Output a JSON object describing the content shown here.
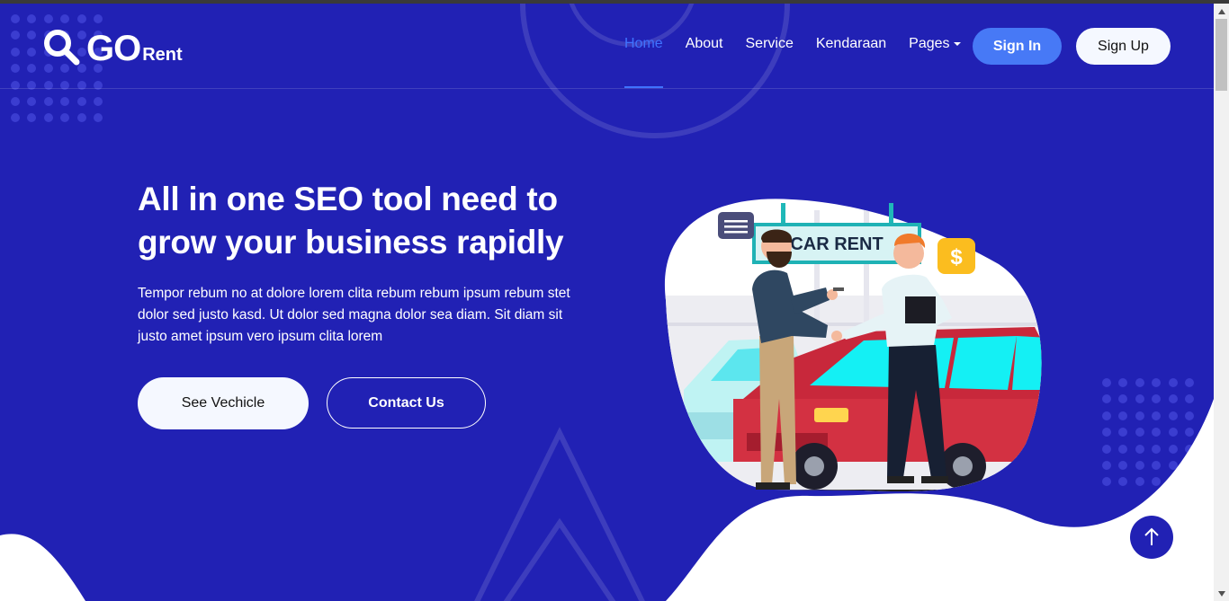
{
  "brand": {
    "name_main": "GO",
    "name_sub": "Rent",
    "icon": "search-icon"
  },
  "nav": {
    "items": [
      {
        "label": "Home",
        "active": true
      },
      {
        "label": "About"
      },
      {
        "label": "Service"
      },
      {
        "label": "Kendaraan"
      },
      {
        "label": "Pages",
        "dropdown": true
      }
    ],
    "signin_label": "Sign In",
    "signup_label": "Sign Up"
  },
  "hero": {
    "headline_line1": "All in one SEO tool need to",
    "headline_line2": "grow your business rapidly",
    "description": "Tempor rebum no at dolore lorem clita rebum rebum ipsum rebum stet dolor sed justo kasd. Ut dolor sed magna dolor sea diam. Sit diam sit justo amet ipsum vero ipsum clita lorem",
    "primary_button": "See Vechicle",
    "secondary_button": "Contact Us"
  },
  "illustration": {
    "sign_text": "CAR RENT",
    "price_icon": "$"
  },
  "colors": {
    "background": "#2121b4",
    "accent": "#4779f6",
    "active_link": "#3f73ff",
    "light": "#f5f8ff"
  }
}
